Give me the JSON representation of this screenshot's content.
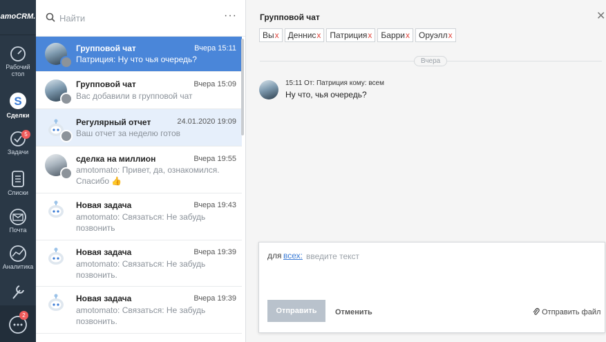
{
  "brand": {
    "logo_text": "amoCRM."
  },
  "nav": {
    "items": [
      {
        "label_1": "Рабочий",
        "label_2": "стол",
        "icon": "dashboard-icon"
      },
      {
        "label": "Сделки",
        "icon": "leads-icon"
      },
      {
        "label": "Задачи",
        "icon": "tasks-icon",
        "badge": "5"
      },
      {
        "label": "Списки",
        "icon": "lists-icon"
      },
      {
        "label": "Почта",
        "icon": "mail-icon"
      },
      {
        "label": "Аналитика",
        "icon": "analytics-icon"
      },
      {
        "label": "",
        "icon": "settings-icon"
      }
    ],
    "chat_badge": "2"
  },
  "search": {
    "placeholder": "Найти",
    "more_label": "···"
  },
  "chats": [
    {
      "title": "Групповой чат",
      "time": "Вчера 15:11",
      "message": "Патриция: Ну что чья очередь?"
    },
    {
      "title": "Групповой чат",
      "time": "Вчера 15:09",
      "message": "Вас добавили в групповой чат"
    },
    {
      "title": "Регулярный отчет",
      "time": "24.01.2020 19:09",
      "message": "Ваш отчет за неделю готов"
    },
    {
      "title": "сделка на миллион",
      "time": "Вчера 19:55",
      "message": "amotomato: Привет, да, ознакомился. Спасибо 👍"
    },
    {
      "title": "Новая задача",
      "time": "Вчера 19:43",
      "message": "amotomato: Связаться: Не забудь позвонить"
    },
    {
      "title": "Новая задача",
      "time": "Вчера 19:39",
      "message": "amotomato: Связаться: Не забудь позвонить."
    },
    {
      "title": "Новая задача",
      "time": "Вчера 19:39",
      "message": "amotomato: Связаться: Не забудь позвонить."
    }
  ],
  "conversation": {
    "title": "Групповой чат",
    "close_label": "✕",
    "participants": [
      "Вы",
      "Деннис",
      "Патриция",
      "Барри",
      "Оруэлл"
    ],
    "remove_mark": "x",
    "date_divider": "Вчера",
    "message": {
      "meta": "15:11 От: Патриция кому: всем",
      "text": "Ну что, чья очередь?"
    }
  },
  "composer": {
    "for_label": "для",
    "recipient": "всех:",
    "placeholder": "введите текст",
    "send_label": "Отправить",
    "cancel_label": "Отменить",
    "attach_label": "Отправить файл"
  },
  "colors": {
    "nav_bg": "#2a3846",
    "selected": "#4a86d9",
    "highlight": "#e6effb",
    "badge": "#f05b5b",
    "link": "#3a7bd5"
  }
}
